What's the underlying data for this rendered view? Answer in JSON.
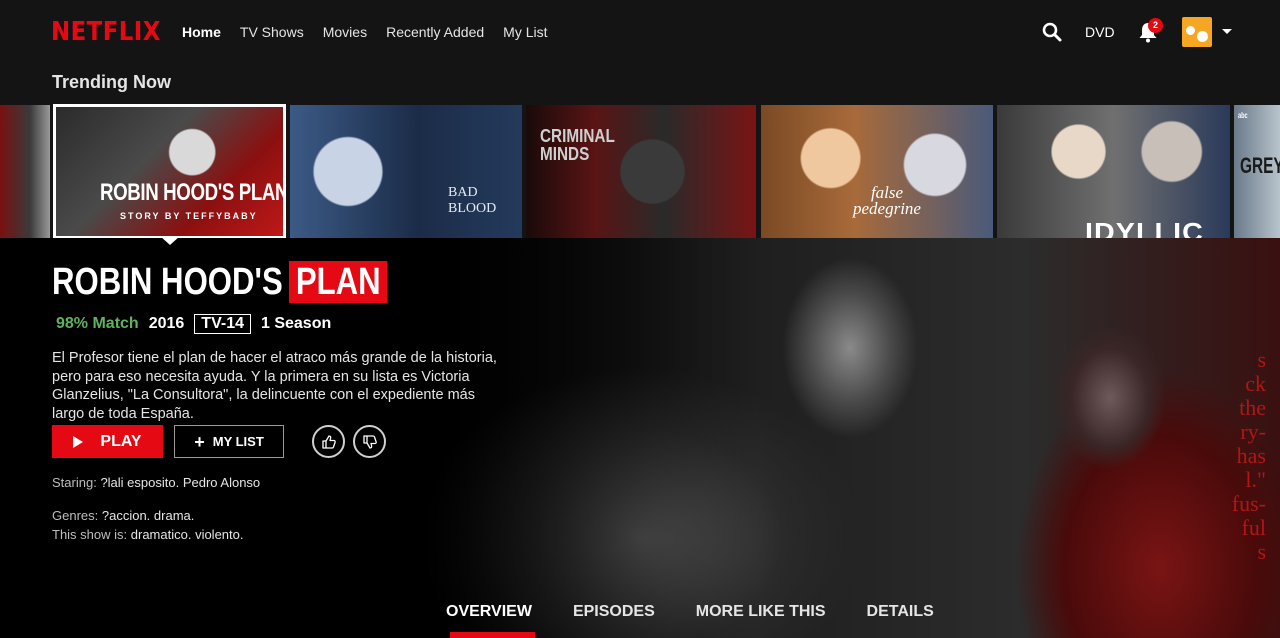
{
  "brand": {
    "logo": "NETFLIX",
    "accent": "#e50914",
    "match_color": "#5fb35f"
  },
  "nav": {
    "links": [
      {
        "label": "Home",
        "active": true
      },
      {
        "label": "TV Shows",
        "active": false
      },
      {
        "label": "Movies",
        "active": false
      },
      {
        "label": "Recently Added",
        "active": false
      },
      {
        "label": "My List",
        "active": false
      }
    ],
    "dvd_label": "DVD",
    "notification_count": "2",
    "icons": [
      "search-icon",
      "bell-icon",
      "avatar",
      "caret-down-icon"
    ]
  },
  "row": {
    "title": "Trending Now",
    "thumbnails": [
      {
        "name": "partial-left",
        "text": ""
      },
      {
        "name": "robin-hoods-plan",
        "title_word1": "ROBIN HOOD'S ",
        "title_word2": "PLAN",
        "subtitle": "STORY BY TEFFYBABY",
        "selected": true
      },
      {
        "name": "bad-blood",
        "text_line1": "BAD",
        "text_line2": "BLOOD"
      },
      {
        "name": "criminal-minds",
        "text_line1": "CRIMINAL",
        "text_line2": "MINDS"
      },
      {
        "name": "false-pedegrine",
        "text_line1": "false",
        "text_line2": "pedegrine"
      },
      {
        "name": "idyllic",
        "text": "IDYLLIC"
      },
      {
        "name": "partial-right",
        "text": "GREY",
        "network": "abc"
      }
    ]
  },
  "hero": {
    "title_word1": "ROBIN HOOD'S",
    "title_word2": "PLAN",
    "match": "98% Match",
    "year": "2016",
    "rating": "TV-14",
    "seasons": "1 Season",
    "synopsis": "El Profesor tiene el plan de hacer el atraco más grande de la historia, pero para eso necesita ayuda. Y la primera en su lista es Victoria Glanzelius, \"La Consultora\", la delincuente con el expediente más largo de toda España.",
    "play_label": "PLAY",
    "mylist_label": "MY LIST",
    "starring_key": "Staring:",
    "starring_val": "?lali esposito. Pedro Alonso",
    "genres_key": "Genres:",
    "genres_val": "?accion. drama.",
    "show_is_key": "This show is:",
    "show_is_val": "dramatico. violento.",
    "bg_text": [
      "s",
      "ck",
      "the",
      "ry-",
      "has",
      "l.\"",
      "fus-",
      "ful",
      "s"
    ]
  },
  "tabs": [
    {
      "label": "OVERVIEW",
      "active": true
    },
    {
      "label": "EPISODES",
      "active": false
    },
    {
      "label": "MORE LIKE THIS",
      "active": false
    },
    {
      "label": "DETAILS",
      "active": false
    }
  ]
}
